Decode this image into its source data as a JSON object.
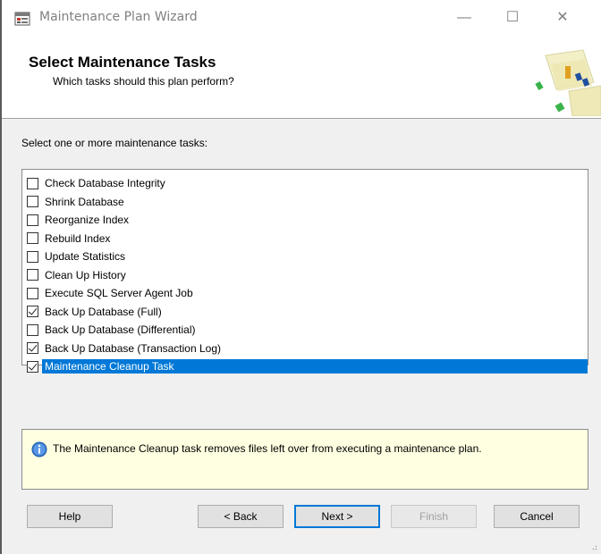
{
  "window": {
    "title": "Maintenance Plan Wizard",
    "controls": {
      "minimize": "—",
      "maximize": "☐",
      "close": "✕"
    }
  },
  "header": {
    "title": "Select Maintenance Tasks",
    "subtitle": "Which tasks should this plan perform?"
  },
  "main": {
    "prompt": "Select one or more maintenance tasks:",
    "tasks": [
      {
        "label": "Check Database Integrity",
        "checked": false
      },
      {
        "label": "Shrink Database",
        "checked": false
      },
      {
        "label": "Reorganize Index",
        "checked": false
      },
      {
        "label": "Rebuild Index",
        "checked": false
      },
      {
        "label": "Update Statistics",
        "checked": false
      },
      {
        "label": "Clean Up History",
        "checked": false
      },
      {
        "label": "Execute SQL Server Agent Job",
        "checked": false
      },
      {
        "label": "Back Up Database (Full)",
        "checked": true
      },
      {
        "label": "Back Up Database (Differential)",
        "checked": false
      },
      {
        "label": "Back Up Database (Transaction Log)",
        "checked": true
      },
      {
        "label": "Maintenance Cleanup Task",
        "checked": true,
        "selected": true
      }
    ],
    "info": "The Maintenance Cleanup task removes files left over from executing a maintenance plan."
  },
  "buttons": {
    "help": "Help",
    "back": "< Back",
    "next": "Next >",
    "finish": "Finish",
    "cancel": "Cancel"
  },
  "colors": {
    "selection": "#0078d7",
    "info_background": "#ffffe1",
    "dialog_background": "#f0f0f0"
  },
  "icons": {
    "app": "maintenance-plan-icon",
    "info": "info-icon",
    "wizard": "wizard-graphic"
  }
}
